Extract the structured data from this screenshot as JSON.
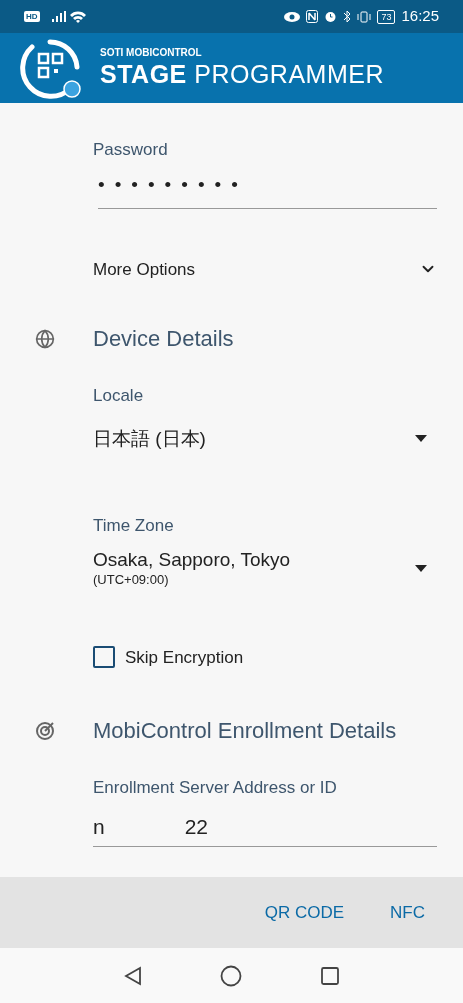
{
  "status_bar": {
    "hd": "HD",
    "battery": "73",
    "time": "16:25"
  },
  "header": {
    "brand": "SOTI MOBICONTROL",
    "title_bold": "STAGE",
    "title_light": "PROGRAMMER"
  },
  "password": {
    "label": "Password",
    "value": "•••••••••"
  },
  "more_options": {
    "label": "More Options",
    "expanded": false
  },
  "device_details": {
    "title": "Device Details",
    "locale": {
      "label": "Locale",
      "value": "日本語 (日本)"
    },
    "time_zone": {
      "label": "Time Zone",
      "value": "Osaka, Sapporo, Tokyo",
      "offset": "(UTC+09:00)"
    },
    "skip_encryption": {
      "label": "Skip Encryption",
      "checked": false
    }
  },
  "enrollment": {
    "title": "MobiControl Enrollment Details",
    "label": "Enrollment Server Address or ID",
    "value_start": "n",
    "value_end": "22"
  },
  "actions": [
    "QR CODE",
    "NFC"
  ]
}
